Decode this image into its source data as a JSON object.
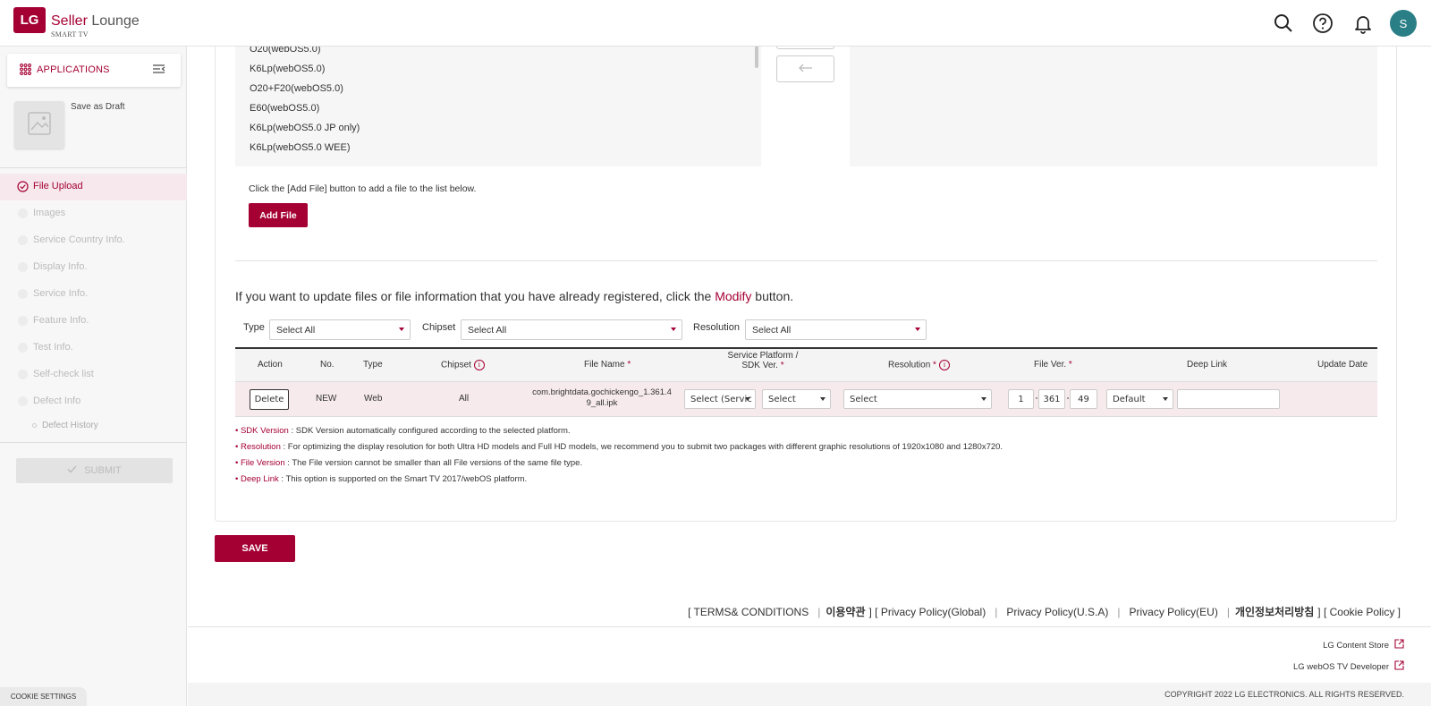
{
  "header": {
    "logo": "LG",
    "brand_main": "Seller",
    "brand_rest": "Lounge",
    "brand_sub": "SMART TV",
    "avatar_initial": "S",
    "icons": [
      "search-icon",
      "help-icon",
      "bell-icon"
    ]
  },
  "sidebar": {
    "section_label": "APPLICATIONS",
    "draft_label": "Save as Draft",
    "nav": [
      {
        "label": "File Upload",
        "active": true
      },
      {
        "label": "Images"
      },
      {
        "label": "Service Country Info."
      },
      {
        "label": "Display Info."
      },
      {
        "label": "Service Info."
      },
      {
        "label": "Feature Info."
      },
      {
        "label": "Test Info."
      },
      {
        "label": "Self-check list"
      },
      {
        "label": "Defect Info"
      }
    ],
    "sub_nav": "Defect History",
    "submit_label": "SUBMIT",
    "cookie_label": "COOKIE SETTINGS"
  },
  "chipsets": [
    "O20(webOS5.0)",
    "K6Lp(webOS5.0)",
    "O20+F20(webOS5.0)",
    "E60(webOS5.0)",
    "K6Lp(webOS5.0 JP only)",
    "K6Lp(webOS5.0 WEE)"
  ],
  "upload": {
    "hint": "Click the [Add File] button to add a file to the list below.",
    "add_file": "Add File"
  },
  "update": {
    "title_pre": "If you want to update files or file information that you have already registered, click the ",
    "title_link": "Modify",
    "title_post": " button."
  },
  "filters": {
    "type_label": "Type",
    "type_value": "Select All",
    "chipset_label": "Chipset",
    "chipset_value": "Select All",
    "resolution_label": "Resolution",
    "resolution_value": "Select All"
  },
  "table": {
    "headers": {
      "action": "Action",
      "no": "No.",
      "type": "Type",
      "chipset": "Chipset",
      "file_name": "File Name",
      "platform_1": "Service Platform /",
      "platform_2": "SDK Ver.",
      "resolution": "Resolution",
      "file_ver": "File Ver.",
      "deep_link": "Deep Link",
      "update_date": "Update Date"
    },
    "row": {
      "action": "Delete",
      "no": "NEW",
      "type": "Web",
      "chipset": "All",
      "file_name_1": "com.brightdata.gochickengo_1.361.4",
      "file_name_2": "9_all.ipk",
      "platform": "Select (Servic",
      "sdk": "Select",
      "resolution": "Select",
      "ver_major": "1",
      "ver_minor": "361",
      "ver_patch": "49",
      "deep_link_mode": "Default",
      "deep_link_value": ""
    }
  },
  "notes": [
    {
      "key": "SDK Version",
      "text": " : SDK Version automatically configured according to the selected platform."
    },
    {
      "key": "Resolution",
      "text": " : For optimizing the display resolution for both Ultra HD models and Full HD models, we recommend you to submit two packages with different graphic resolutions of 1920x1080 and 1280x720."
    },
    {
      "key": "File Version",
      "text": " : The File version cannot be smaller than all File versions of the same file type."
    },
    {
      "key": "Deep Link",
      "text": " : This option is supported on the Smart TV 2017/webOS platform."
    }
  ],
  "save_label": "SAVE",
  "footer": {
    "terms": "[ TERMS& CONDITIONS",
    "terms_kr": "이용약관",
    "privacy_global": "] [ Privacy Policy(Global)",
    "privacy_usa": "Privacy Policy(U.S.A)",
    "privacy_eu": "Privacy Policy(EU)",
    "privacy_kr": "개인정보처리방침",
    "cookie_policy": "] [ Cookie Policy ]",
    "content_store": "LG Content Store",
    "webos_dev": "LG webOS TV Developer",
    "copyright": "COPYRIGHT 2022 LG ELECTRONICS. ALL RIGHTS RESERVED."
  },
  "colors": {
    "brand": "#a50034",
    "avatar": "#2a7f86"
  }
}
